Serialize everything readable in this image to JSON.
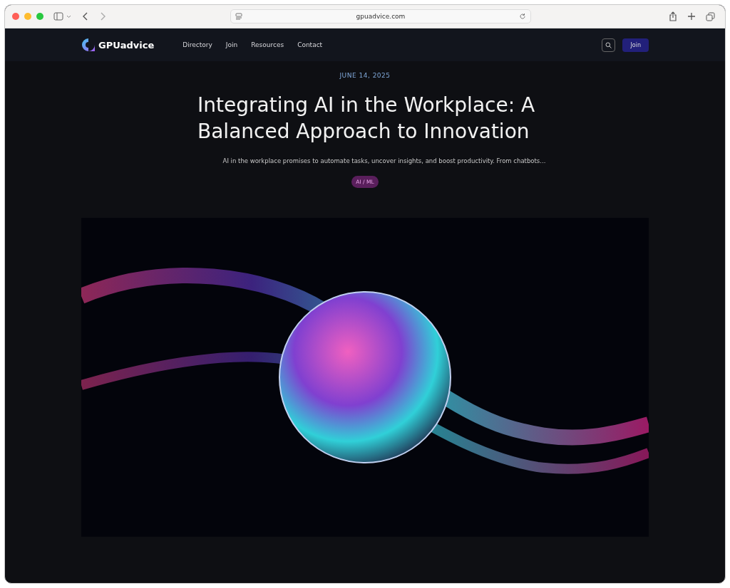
{
  "browser": {
    "url": "gpuadvice.com"
  },
  "nav": {
    "logo": "GPUadvice",
    "links": [
      "Directory",
      "Join",
      "Resources",
      "Contact"
    ],
    "button": "Join"
  },
  "article": {
    "date": "JUNE 14, 2025",
    "title": "Integrating AI in the Workplace: A Balanced Approach to Innovation",
    "excerpt": "AI in the workplace promises to automate tasks, uncover insights, and boost productivity. From chatbots...",
    "tag": "AI / ML"
  }
}
